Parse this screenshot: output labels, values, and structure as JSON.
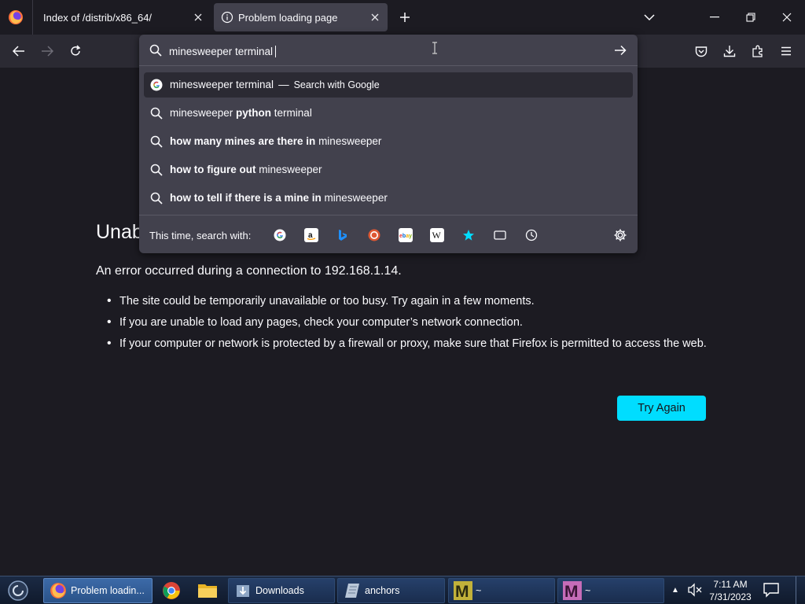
{
  "browser": {
    "tabs": [
      {
        "title": "Index of /distrib/x86_64/",
        "active": false
      },
      {
        "title": "Problem loading page",
        "active": true
      }
    ]
  },
  "urlbar": {
    "value": "minesweeper terminal",
    "suggestions": [
      {
        "parts": [
          {
            "text": "minesweeper terminal",
            "bold": false
          }
        ],
        "dash": "—",
        "action": "Search with Google",
        "icon": "google-icon"
      },
      {
        "parts": [
          {
            "text": "minesweeper ",
            "bold": false
          },
          {
            "text": "python",
            "bold": true
          },
          {
            "text": " terminal",
            "bold": false
          }
        ],
        "icon": "search-icon"
      },
      {
        "parts": [
          {
            "text": "how many mines are there in",
            "bold": true
          },
          {
            "text": " minesweeper",
            "bold": false
          }
        ],
        "icon": "search-icon"
      },
      {
        "parts": [
          {
            "text": "how to figure out",
            "bold": true
          },
          {
            "text": " minesweeper",
            "bold": false
          }
        ],
        "icon": "search-icon"
      },
      {
        "parts": [
          {
            "text": "how to tell if there is a mine in",
            "bold": true
          },
          {
            "text": " minesweeper",
            "bold": false
          }
        ],
        "icon": "search-icon"
      }
    ],
    "oneoff_label": "This time, search with:",
    "engines": [
      "google-icon",
      "amazon-icon",
      "bing-icon",
      "duckduckgo-icon",
      "ebay-icon",
      "wikipedia-icon",
      "bookmarks-star-icon",
      "tabs-icon",
      "history-icon"
    ]
  },
  "page": {
    "heading_visible": "Unab",
    "description": "An error occurred during a connection to 192.168.1.14.",
    "bullets": [
      "The site could be temporarily unavailable or too busy. Try again in a few moments.",
      "If you are unable to load any pages, check your computer’s network connection.",
      "If your computer or network is protected by a firewall or proxy, make sure that Firefox is permitted to access the web."
    ],
    "try_again_label": "Try Again"
  },
  "taskbar": {
    "items": [
      {
        "label": "Problem loadin...",
        "active": true
      },
      {
        "label": "Downloads",
        "active": false
      },
      {
        "label": "anchors",
        "active": false
      },
      {
        "label": "~",
        "active": false
      },
      {
        "label": "~",
        "active": false
      }
    ],
    "clock_time": "7:11 AM",
    "clock_date": "7/31/2023"
  },
  "colors": {
    "accent": "#00ddff",
    "page_bg": "#1c1b22",
    "toolbar_bg": "#2b2a33",
    "panel_bg": "#42414d"
  }
}
